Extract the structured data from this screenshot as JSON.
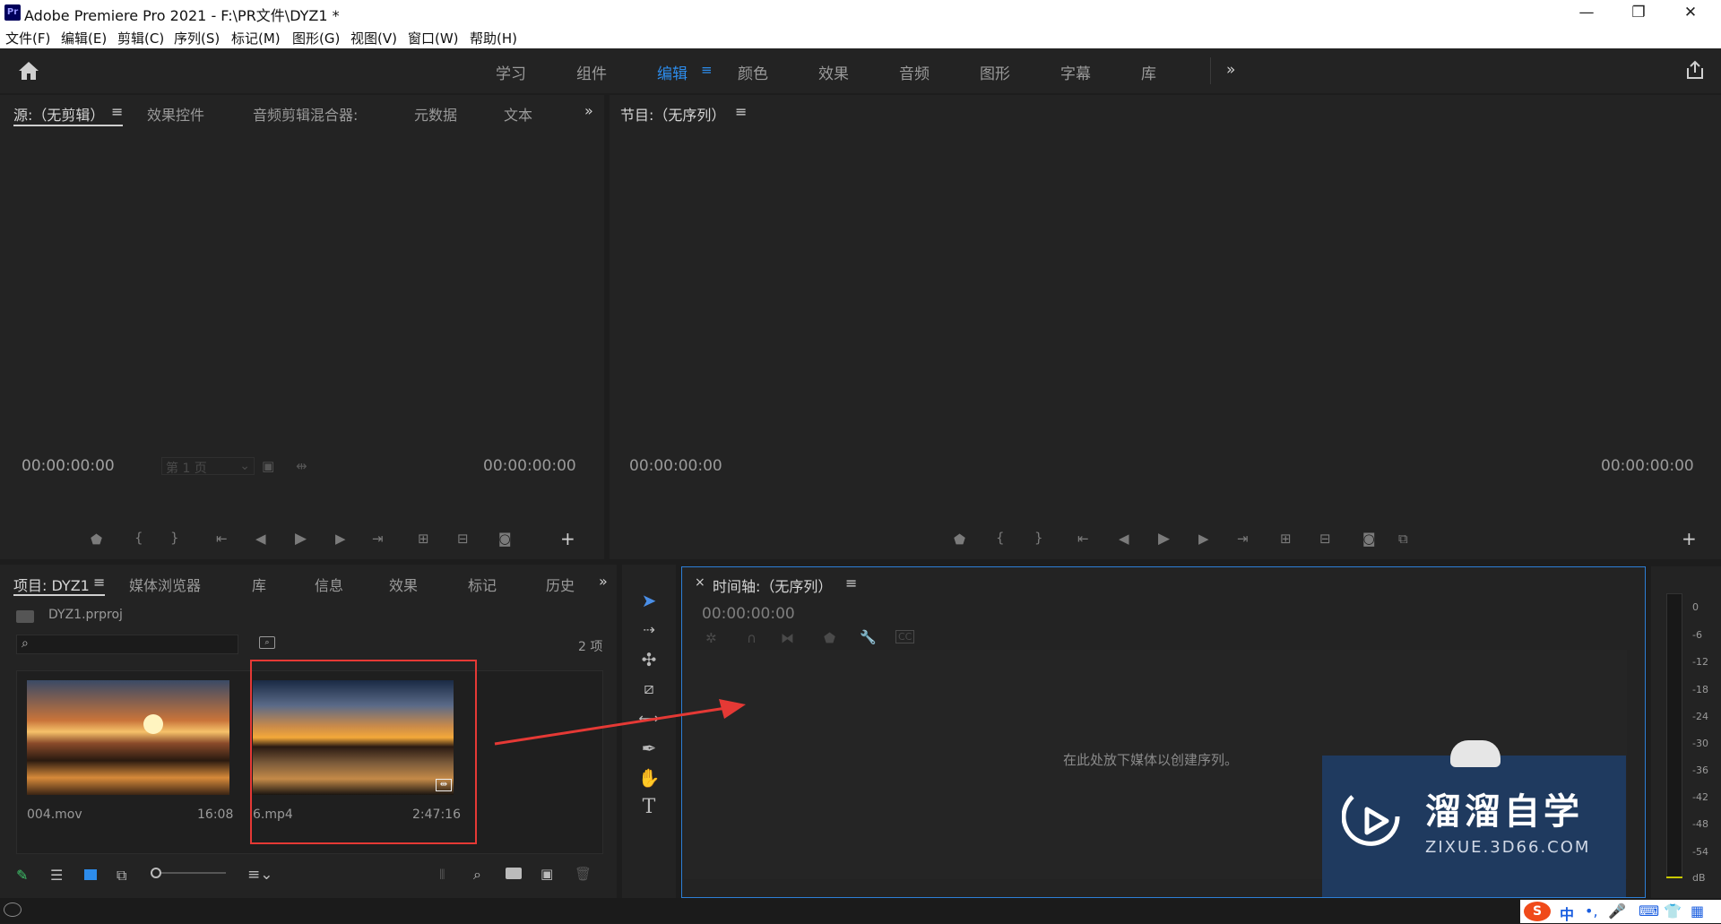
{
  "window": {
    "app_icon": "Pr",
    "title": "Adobe Premiere Pro 2021 - F:\\PR文件\\DYZ1 *",
    "controls": [
      "—",
      "❐",
      "✕"
    ]
  },
  "menu": [
    "文件(F)",
    "编辑(E)",
    "剪辑(C)",
    "序列(S)",
    "标记(M)",
    "图形(G)",
    "视图(V)",
    "窗口(W)",
    "帮助(H)"
  ],
  "workspaces": {
    "tabs": [
      "学习",
      "组件",
      "编辑",
      "颜色",
      "效果",
      "音频",
      "图形",
      "字幕",
      "库"
    ],
    "active": "编辑",
    "more": "»"
  },
  "source_panel": {
    "tabs": [
      "源:（无剪辑）",
      "效果控件",
      "音频剪辑混合器:",
      "元数据",
      "文本"
    ],
    "more": "»",
    "timecode_left": "00:00:00:00",
    "timecode_right": "00:00:00:00",
    "page_select": "第 1 页"
  },
  "program_panel": {
    "title": "节目:（无序列）",
    "timecode_left": "00:00:00:00",
    "timecode_right": "00:00:00:00"
  },
  "project_panel": {
    "tabs": [
      "项目: DYZ1",
      "媒体浏览器",
      "库",
      "信息",
      "效果",
      "标记",
      "历史"
    ],
    "more": "»",
    "file": "DYZ1.prproj",
    "item_count": "2 项",
    "items": [
      {
        "name": "004.mov",
        "duration": "16:08"
      },
      {
        "name": "6.mp4",
        "duration": "2:47:16"
      }
    ]
  },
  "timeline_panel": {
    "close": "×",
    "title": "时间轴:（无序列）",
    "timecode": "00:00:00:00",
    "drop_hint": "在此处放下媒体以创建序列。"
  },
  "audio_meter": {
    "scale": [
      "0",
      "-6",
      "-12",
      "-18",
      "-24",
      "-30",
      "-36",
      "-42",
      "-48",
      "-54",
      "dB"
    ]
  },
  "watermark": {
    "title": "溜溜自学",
    "url": "ZIXUE.3D66.COM"
  },
  "taskbar_ime": "中",
  "colors": {
    "accent": "#2d8ceb",
    "highlight_box": "#e53935",
    "arrow": "#e53935",
    "watermark_bg": "#1f3a5f"
  }
}
